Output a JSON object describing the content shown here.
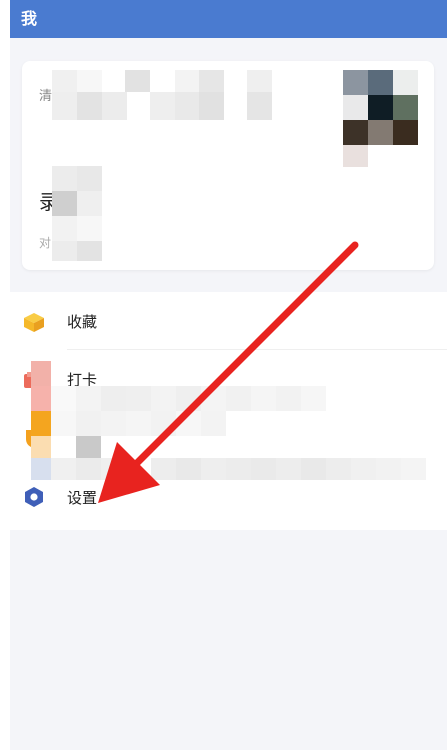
{
  "header": {
    "title": "我"
  },
  "profile": {
    "name_label": "清",
    "big_char": "录",
    "small_char": "对"
  },
  "menu": {
    "items": [
      {
        "label": "收藏",
        "icon": "box-icon"
      },
      {
        "label": "打卡",
        "icon": "book-icon"
      },
      {
        "label": "",
        "icon": "shield-icon"
      },
      {
        "label": "",
        "icon": "grid-icon"
      },
      {
        "label": "设置",
        "icon": "gear-icon"
      }
    ]
  },
  "colors": {
    "header_bg": "#4a7bd0",
    "arrow": "#e8231f",
    "box_icon": "#f5b82a",
    "settings_icon": "#3f5fb8"
  }
}
